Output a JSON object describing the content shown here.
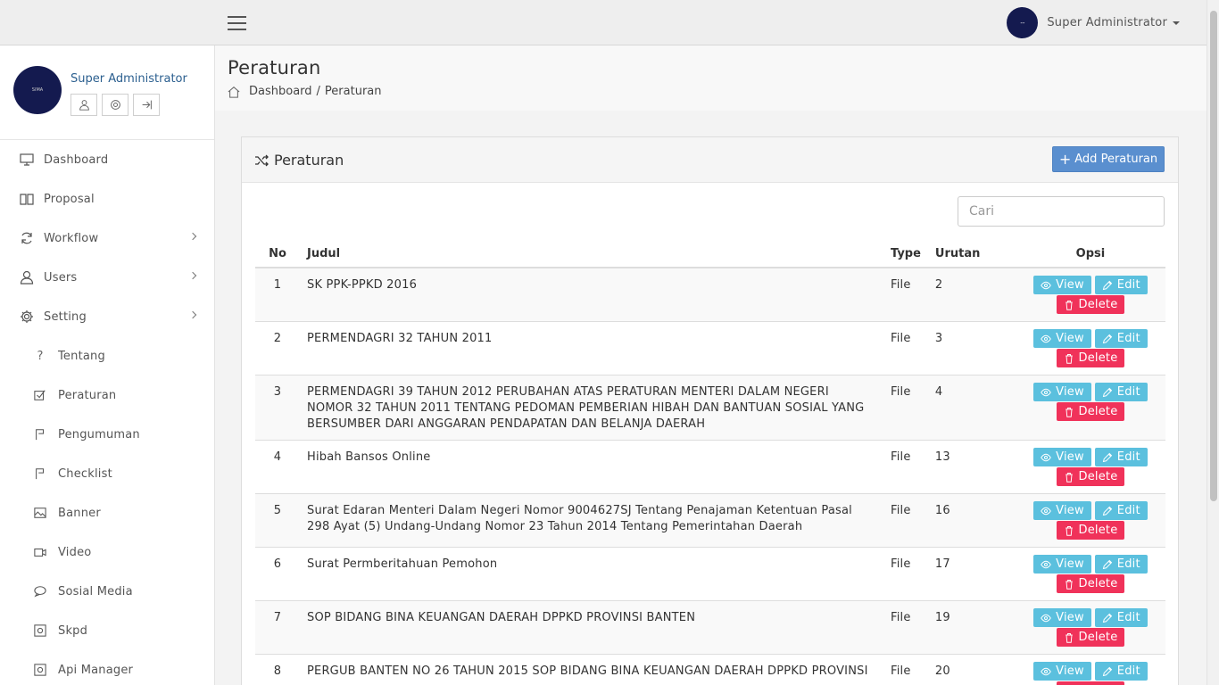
{
  "header": {
    "user_name": "Super Administrator",
    "avatar_text": "--"
  },
  "sidebar": {
    "profile_name": "Super Administrator",
    "avatar_text": "SIMA",
    "items": [
      {
        "label": "Dashboard",
        "icon": "monitor-icon"
      },
      {
        "label": "Proposal",
        "icon": "book-icon"
      },
      {
        "label": "Workflow",
        "icon": "refresh-icon"
      },
      {
        "label": "Users",
        "icon": "user-icon"
      },
      {
        "label": "Setting",
        "icon": "gear-icon"
      }
    ],
    "submenu": [
      {
        "label": "Tentang",
        "icon": "question-icon"
      },
      {
        "label": "Peraturan",
        "icon": "checkbox-icon"
      },
      {
        "label": "Pengumuman",
        "icon": "flag-icon"
      },
      {
        "label": "Checklist",
        "icon": "flag-icon"
      },
      {
        "label": "Banner",
        "icon": "image-icon"
      },
      {
        "label": "Video",
        "icon": "video-icon"
      },
      {
        "label": "Sosial Media",
        "icon": "chat-icon"
      },
      {
        "label": "Skpd",
        "icon": "target-icon"
      },
      {
        "label": "Api Manager",
        "icon": "target-icon"
      }
    ]
  },
  "page": {
    "title": "Peraturan",
    "breadcrumb": [
      "Dashboard",
      "Peraturan"
    ]
  },
  "panel": {
    "title": "Peraturan",
    "add_label": "Add Peraturan",
    "search_placeholder": "Cari"
  },
  "table": {
    "headers": [
      "No",
      "Judul",
      "Type",
      "Urutan",
      "Opsi"
    ],
    "view_label": "View",
    "edit_label": "Edit",
    "delete_label": "Delete",
    "rows": [
      {
        "no": "1",
        "judul": "SK PPK-PPKD 2016",
        "type": "File",
        "urutan": "2"
      },
      {
        "no": "2",
        "judul": "PERMENDAGRI 32 TAHUN 2011",
        "type": "File",
        "urutan": "3"
      },
      {
        "no": "3",
        "judul": "PERMENDAGRI 39 TAHUN 2012 PERUBAHAN ATAS PERATURAN MENTERI DALAM NEGERI NOMOR 32 TAHUN 2011 TENTANG PEDOMAN PEMBERIAN HIBAH DAN BANTUAN SOSIAL YANG BERSUMBER DARI ANGGARAN PENDAPATAN DAN BELANJA DAERAH",
        "type": "File",
        "urutan": "4"
      },
      {
        "no": "4",
        "judul": "Hibah Bansos Online",
        "type": "File",
        "urutan": "13"
      },
      {
        "no": "5",
        "judul": "Surat Edaran Menteri Dalam Negeri Nomor 9004627SJ Tentang Penajaman Ketentuan Pasal 298 Ayat (5) Undang-Undang Nomor 23 Tahun 2014 Tentang Pemerintahan Daerah",
        "type": "File",
        "urutan": "16"
      },
      {
        "no": "6",
        "judul": "Surat Permberitahuan Pemohon",
        "type": "File",
        "urutan": "17"
      },
      {
        "no": "7",
        "judul": "SOP BIDANG BINA KEUANGAN DAERAH DPPKD PROVINSI BANTEN",
        "type": "File",
        "urutan": "19"
      },
      {
        "no": "8",
        "judul": "PERGUB BANTEN NO 26 TAHUN 2015 SOP BIDANG BINA KEUANGAN DAERAH DPPKD PROVINSI",
        "type": "File",
        "urutan": "20"
      }
    ]
  }
}
